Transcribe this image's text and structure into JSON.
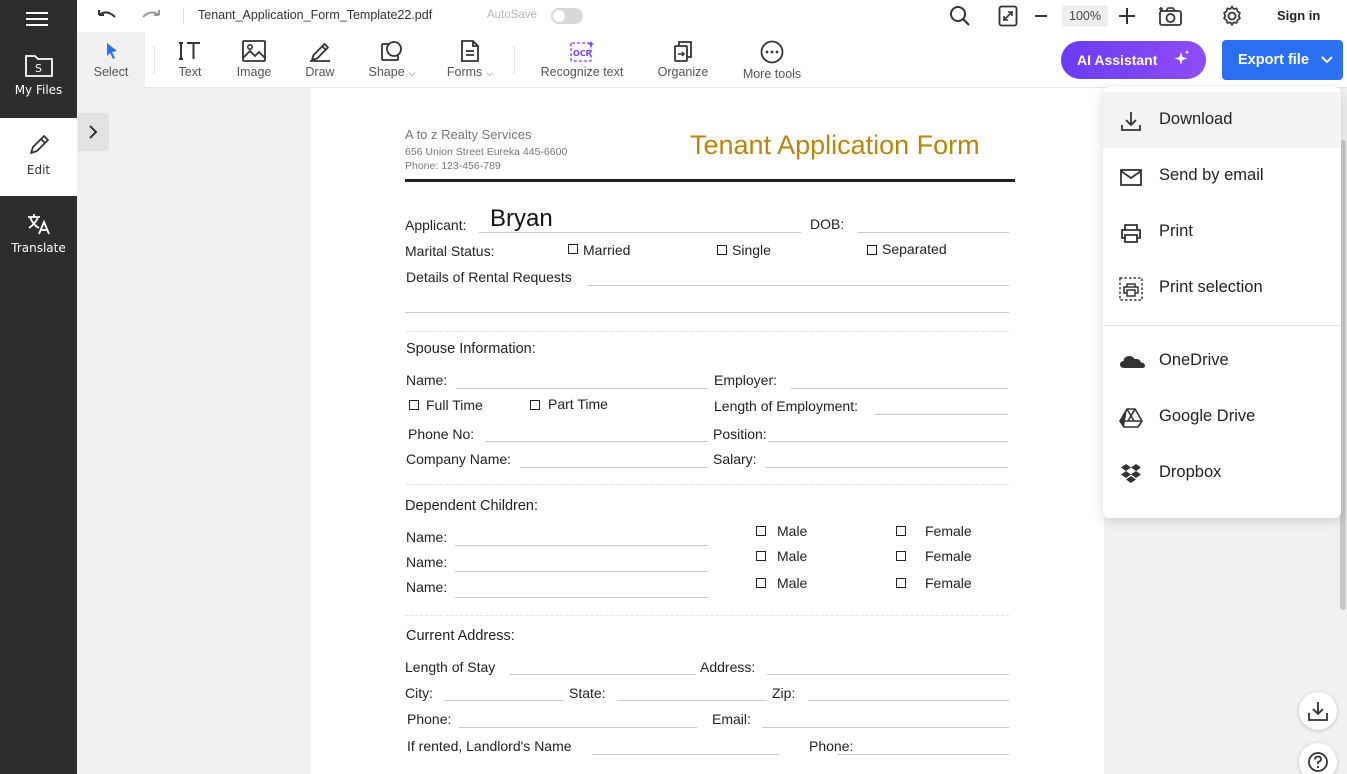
{
  "sidebar": {
    "items": [
      {
        "label": "My Files"
      },
      {
        "label": "Edit"
      },
      {
        "label": "Translate"
      }
    ]
  },
  "topbar": {
    "filename": "Tenant_Application_Form_Template22.pdf",
    "autosave_label": "AutoSave",
    "zoom": "100%",
    "signin_label": "Sign in"
  },
  "toolbar": {
    "tools": [
      {
        "label": "Select"
      },
      {
        "label": "Text"
      },
      {
        "label": "Image"
      },
      {
        "label": "Draw"
      },
      {
        "label": "Shape"
      },
      {
        "label": "Forms"
      },
      {
        "label": "Recognize text"
      },
      {
        "label": "Organize"
      },
      {
        "label": "More tools"
      }
    ],
    "ai_label": "AI Assistant",
    "export_label": "Export file"
  },
  "document": {
    "company": "A to z Realty Services",
    "address": "656 Union Street Eureka 445-6600",
    "phone": "Phone: 123-456-789",
    "title": "Tenant Application Form",
    "applicant_label": "Applicant:",
    "applicant_value": "Bryan",
    "dob_label": "DOB:",
    "marital_label": "Marital Status:",
    "married": "Married",
    "single": "Single",
    "separated": "Separated",
    "rental_label": "Details of Rental Requests",
    "spouse_heading": "Spouse Information:",
    "name_label": "Name:",
    "employer_label": "Employer:",
    "full_time": "Full Time",
    "part_time": "Part Time",
    "length_employment_label": "Length of Employment:",
    "phone_no_label": "Phone No:",
    "position_label": "Position:",
    "company_name_label": "Company Name:",
    "salary_label": "Salary:",
    "dependent_heading": "Dependent Children:",
    "male": "Male",
    "female": "Female",
    "current_address_heading": "Current Address:",
    "length_stay_label": "Length of Stay",
    "address_label": "Address:",
    "city_label": "City:",
    "state_label": "State:",
    "zip_label": "Zip:",
    "phone_label": "Phone:",
    "email_label": "Email:",
    "landlord_label": "If rented, Landlord's Name"
  },
  "export_menu": {
    "items": [
      {
        "label": "Download",
        "icon": "download-icon"
      },
      {
        "label": "Send by email",
        "icon": "mail-icon"
      },
      {
        "label": "Print",
        "icon": "printer-icon"
      },
      {
        "label": "Print selection",
        "icon": "print-selection-icon"
      },
      {
        "label": "OneDrive",
        "icon": "onedrive-icon"
      },
      {
        "label": "Google Drive",
        "icon": "google-drive-icon"
      },
      {
        "label": "Dropbox",
        "icon": "dropbox-icon"
      }
    ]
  },
  "colors": {
    "accent_blue": "#2a6ff0",
    "ai_purple": "#7b44f2",
    "title_gold": "#b8860b",
    "sidebar": "#2d2d2d"
  }
}
